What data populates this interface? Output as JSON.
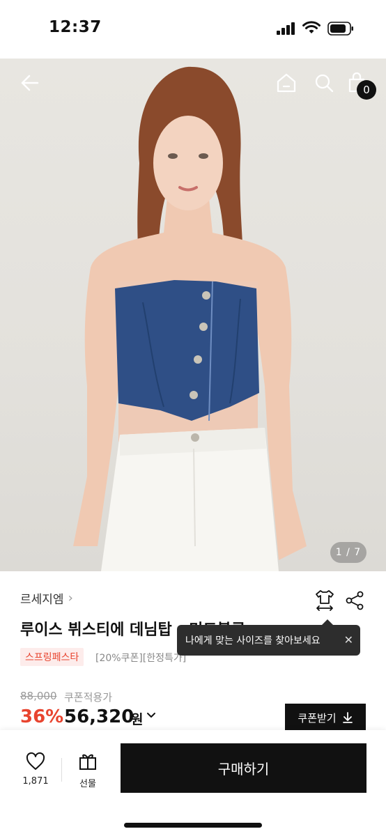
{
  "status_bar": {
    "time": "12:37"
  },
  "header": {
    "cart_count": "0",
    "icons": [
      "back-arrow-icon",
      "home-icon",
      "search-icon",
      "cart-icon"
    ]
  },
  "gallery": {
    "counter": "1 / 7"
  },
  "product": {
    "brand": "르세지엠",
    "brand_chevron": "›",
    "title": "루이스 뷔스티에 데님탑 - 미드블루",
    "tag": "스프링페스타",
    "tag_extra": "[20%쿠폰][한정특가]",
    "original_price": "88,000",
    "coupon_label": "쿠폰적용가",
    "discount": "36%",
    "price": "56,320",
    "currency": "원",
    "coupon_button": "쿠폰받기"
  },
  "tooltip": {
    "text": "나에게 맞는 사이즈를 찾아보세요",
    "close": "✕"
  },
  "bottom_bar": {
    "like_count": "1,871",
    "gift_label": "선물",
    "buy_label": "구매하기"
  },
  "colors": {
    "accent": "#e8442f",
    "dark": "#111111",
    "tag_bg": "#fdeceb"
  }
}
